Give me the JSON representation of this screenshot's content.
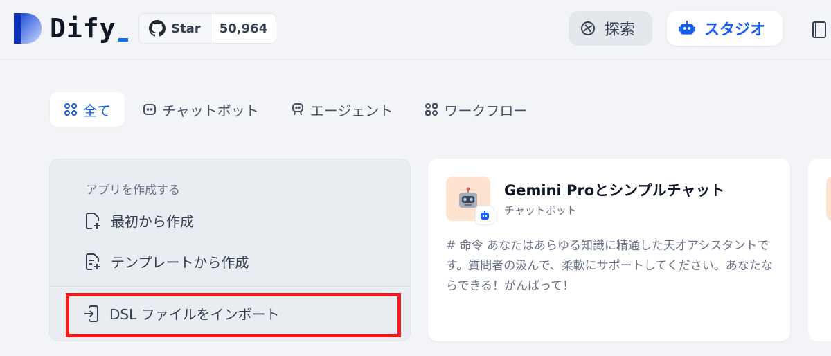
{
  "header": {
    "logo_text": "Dify",
    "github": {
      "star_label": "Star",
      "star_count": "50,964"
    },
    "nav": {
      "explore_label": "探索",
      "studio_label": "スタジオ"
    }
  },
  "tabs": [
    {
      "label": "全て",
      "icon": "grid-icon",
      "active": true
    },
    {
      "label": "チャットボット",
      "icon": "chat-bot-icon",
      "active": false
    },
    {
      "label": "エージェント",
      "icon": "agent-icon",
      "active": false
    },
    {
      "label": "ワークフロー",
      "icon": "workflow-icon",
      "active": false
    }
  ],
  "create_card": {
    "heading": "アプリを作成する",
    "items": [
      {
        "label": "最初から作成",
        "icon": "file-plus-icon"
      },
      {
        "label": "テンプレートから作成",
        "icon": "template-icon"
      }
    ],
    "import_label": "DSL ファイルをインポート"
  },
  "app_card": {
    "title": "Gemini Proとシンプルチャット",
    "type": "チャットボット",
    "description": "# 命令 あなたはあらゆる知識に精通した天才アシスタントです。質問者の汲んで、柔軟にサポートしてください。あなたならできる！がんばって！",
    "avatar_icon": "robot-emoji-icon",
    "avatar_bg": "#fde3d0"
  },
  "colors": {
    "accent": "#155eef",
    "highlight": "#ef1d1d"
  }
}
